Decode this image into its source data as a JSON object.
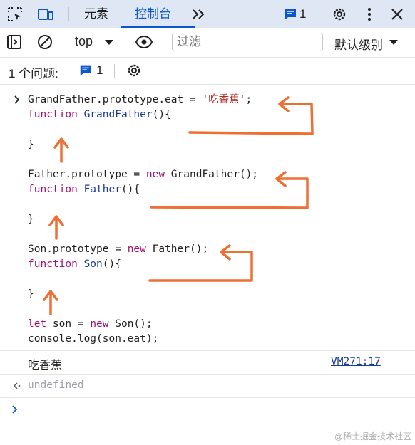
{
  "tabs": {
    "elements": "元素",
    "console": "控制台",
    "issues_count": "1"
  },
  "toolbar": {
    "context": "top",
    "filter_placeholder": "过滤",
    "level": "默认级别"
  },
  "issues_bar": {
    "label": "1 个问题:",
    "count": "1"
  },
  "code_lines": {
    "l1": "GrandFather.prototype.eat = ",
    "l1_str": "'吃香蕉'",
    "l1_end": ";",
    "l2_kw": "function",
    "l2_fn": " GrandFather",
    "l2_end": "(){",
    "l3": "}",
    "l4_a": "Father.prototype = ",
    "l4_kw": "new",
    "l4_b": " GrandFather();",
    "l5_kw": "function",
    "l5_fn": " Father",
    "l5_end": "(){",
    "l6": "}",
    "l7_a": "Son.prototype = ",
    "l7_kw": "new",
    "l7_b": " Father();",
    "l8_kw": "function",
    "l8_fn": " Son",
    "l8_end": "(){",
    "l9": "}",
    "l10_kw": "let",
    "l10_a": " son = ",
    "l10_kw2": "new",
    "l10_b": " Son();",
    "l11": "console.log(son.eat);"
  },
  "output": {
    "log_text": "吃香蕉",
    "source_link": "VM271:17",
    "return_value": "undefined"
  },
  "watermark": "@稀土掘金技术社区",
  "colors": {
    "accent": "#0b57d0",
    "arrow": "#ee6f33"
  }
}
